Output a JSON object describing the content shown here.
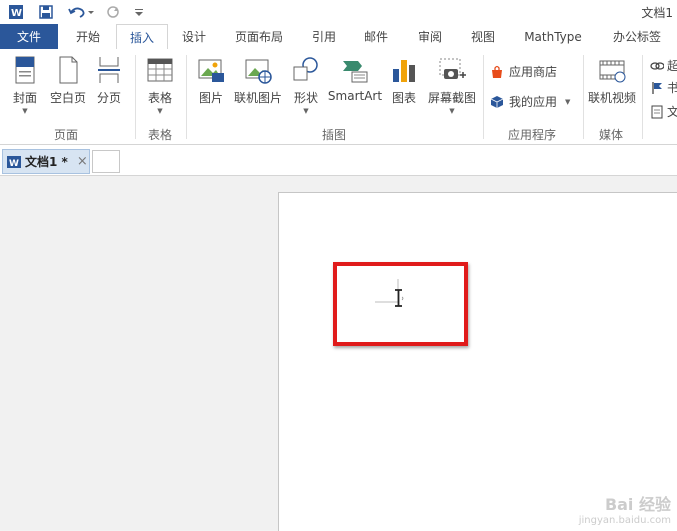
{
  "title_bar": {
    "document_title": "文档1"
  },
  "tabs": {
    "file": "文件",
    "items": [
      "开始",
      "插入",
      "设计",
      "页面布局",
      "引用",
      "邮件",
      "审阅",
      "视图",
      "MathType",
      "办公标签"
    ]
  },
  "ribbon": {
    "pages_group": {
      "label": "页面",
      "cover": "封面",
      "blank_page": "空白页",
      "page_break": "分页"
    },
    "tables_group": {
      "label": "表格",
      "table": "表格"
    },
    "illustrations_group": {
      "label": "插图",
      "pictures": "图片",
      "online_pictures": "联机图片",
      "shapes": "形状",
      "smartart": "SmartArt",
      "chart": "图表",
      "screenshot": "屏幕截图"
    },
    "apps_group": {
      "label": "应用程序",
      "store": "应用商店",
      "my_apps": "我的应用"
    },
    "media_group": {
      "label": "媒体",
      "online_video": "联机视频"
    },
    "links_group": {
      "item1": "超",
      "item2": "书",
      "item3": "文"
    }
  },
  "document_tab": {
    "name": "文档1 *",
    "close": "×"
  },
  "watermark": {
    "brand": "Bai 经验",
    "url": "jingyan.baidu.com"
  },
  "colors": {
    "accent": "#2b579a",
    "highlight": "#e01b1b"
  }
}
